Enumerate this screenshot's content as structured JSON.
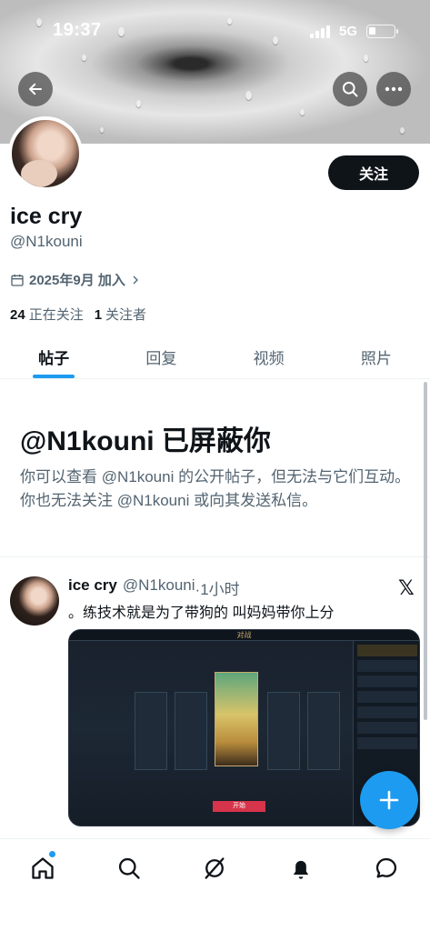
{
  "status_bar": {
    "time": "19:37",
    "network": "5G"
  },
  "profile": {
    "name": "ice cry",
    "handle": "@N1kouni",
    "joined": "2025年9月 加入",
    "following_count": "24",
    "following_label": "正在关注",
    "followers_count": "1",
    "followers_label": "关注者",
    "follow_button": "关注"
  },
  "tabs": [
    {
      "label": "帖子",
      "active": true
    },
    {
      "label": "回复",
      "active": false
    },
    {
      "label": "视频",
      "active": false
    },
    {
      "label": "照片",
      "active": false
    }
  ],
  "blocked": {
    "title": "@N1kouni 已屏蔽你",
    "description": "你可以查看 @N1kouni 的公开帖子，但无法与它们互动。你也无法关注 @N1kouni 或向其发送私信。"
  },
  "post": {
    "author_name": "ice cry",
    "author_handle": "@N1kouni",
    "time": "·1小时",
    "text": "。练技术就是为了带狗的 叫妈妈带你上分",
    "media": {
      "title": "对战",
      "play_button": "开始"
    }
  },
  "colors": {
    "accent": "#1d9bf0",
    "text": "#0f1419",
    "muted": "#536471"
  },
  "icons": [
    "back-arrow-icon",
    "search-icon",
    "more-icon",
    "calendar-icon",
    "chevron-right-icon",
    "x-logo-icon",
    "compose-plus-icon",
    "home-icon",
    "explore-icon",
    "grok-icon",
    "notifications-bell-icon",
    "messages-icon"
  ]
}
